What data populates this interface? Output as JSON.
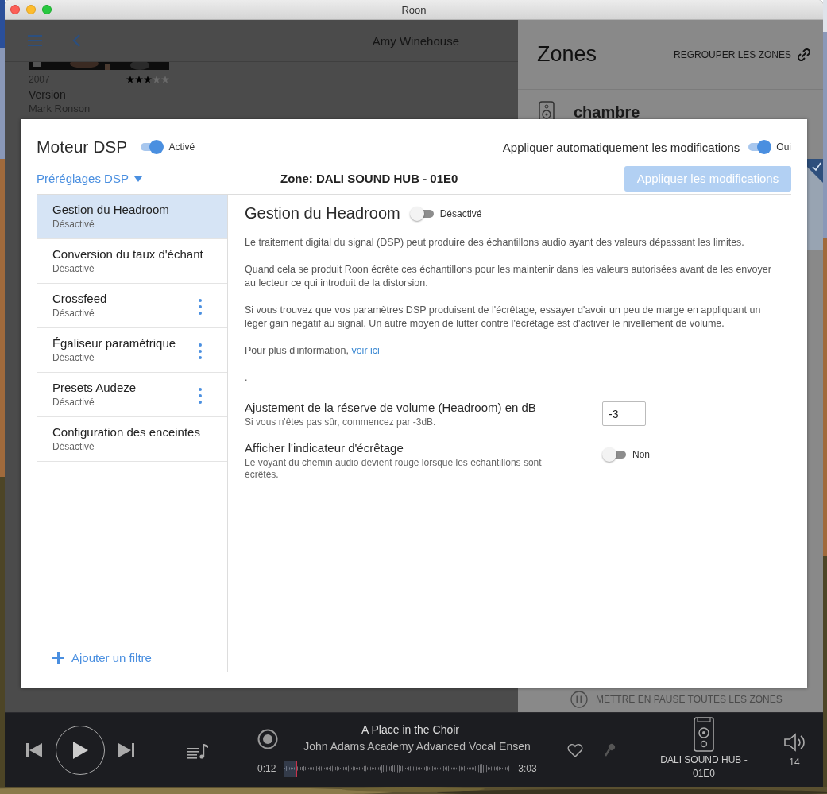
{
  "window": {
    "title": "Roon"
  },
  "library": {
    "header_title": "Amy Winehouse",
    "album": {
      "kind": "picture",
      "year": "2007",
      "stars": 3,
      "title": "Version",
      "artist": "Mark Ronson"
    }
  },
  "zones_panel": {
    "title": "Zones",
    "group_button": "REGROUPER LES ZONES",
    "zone_name": "chambre",
    "pause_all": "METTRE EN PAUSE TOUTES LES ZONES"
  },
  "dsp_dialog": {
    "title": "Moteur DSP",
    "engine": {
      "on": true,
      "label": "Activé"
    },
    "auto_apply": {
      "label": "Appliquer automatiquement les modifications",
      "on": true,
      "state_label": "Oui"
    },
    "presets": "Préréglages DSP",
    "zone": "Zone: DALI SOUND HUB - 01E0",
    "apply_button": {
      "label": "Appliquer les modifications",
      "disabled": true
    },
    "filters": [
      {
        "name": "Gestion du Headroom",
        "status": "Désactivé",
        "has_menu": false,
        "selected": true
      },
      {
        "name": "Conversion du taux d'échant",
        "status": "Désactivé",
        "has_menu": false,
        "selected": false
      },
      {
        "name": "Crossfeed",
        "status": "Désactivé",
        "has_menu": true,
        "selected": false
      },
      {
        "name": "Égaliseur paramétrique",
        "status": "Désactivé",
        "has_menu": true,
        "selected": false
      },
      {
        "name": "Presets Audeze",
        "status": "Désactivé",
        "has_menu": true,
        "selected": false
      },
      {
        "name": "Configuration des enceintes",
        "status": "Désactivé",
        "has_menu": false,
        "selected": false
      }
    ],
    "add_filter": "Ajouter un filtre",
    "detail": {
      "title": "Gestion du Headroom",
      "toggle": {
        "on": false,
        "label": "Désactivé"
      },
      "paragraphs": [
        "Le traitement digital du signal (DSP) peut produire des échantillons audio ayant des valeurs dépassant les limites.",
        "Quand cela se produit Roon écrête ces échantillons pour les maintenir dans les valeurs autorisées avant de les envoyer au lecteur ce qui introduit de la distorsion.",
        "Si vous trouvez que vos paramètres DSP produisent de l'écrêtage, essayer d'avoir un peu de marge en appliquant un léger gain négatif au signal. Un autre moyen de lutter contre l'écrêtage est d'activer le nivellement de volume."
      ],
      "more_info": {
        "text": "Pour plus d'information, ",
        "link": "voir ici"
      },
      "trailing": ".",
      "settings": [
        {
          "kind": "number",
          "label": "Ajustement de la réserve de volume (Headroom) en dB",
          "hint": "Si vous n'êtes pas sûr, commencez par -3dB.",
          "value": "-3"
        },
        {
          "kind": "toggle",
          "label": "Afficher l'indicateur d'écrêtage",
          "hint": "Le voyant du chemin audio devient rouge lorsque les échantillons sont écrêtés.",
          "on": false,
          "state_label": "Non"
        }
      ]
    }
  },
  "player": {
    "track": "A Place in the Choir",
    "artist": "John Adams Academy Advanced Vocal Ensen",
    "elapsed": "0:12",
    "duration": "3:03",
    "level": 0.06,
    "zone": "DALI SOUND HUB - 01E0",
    "volume": "14"
  }
}
